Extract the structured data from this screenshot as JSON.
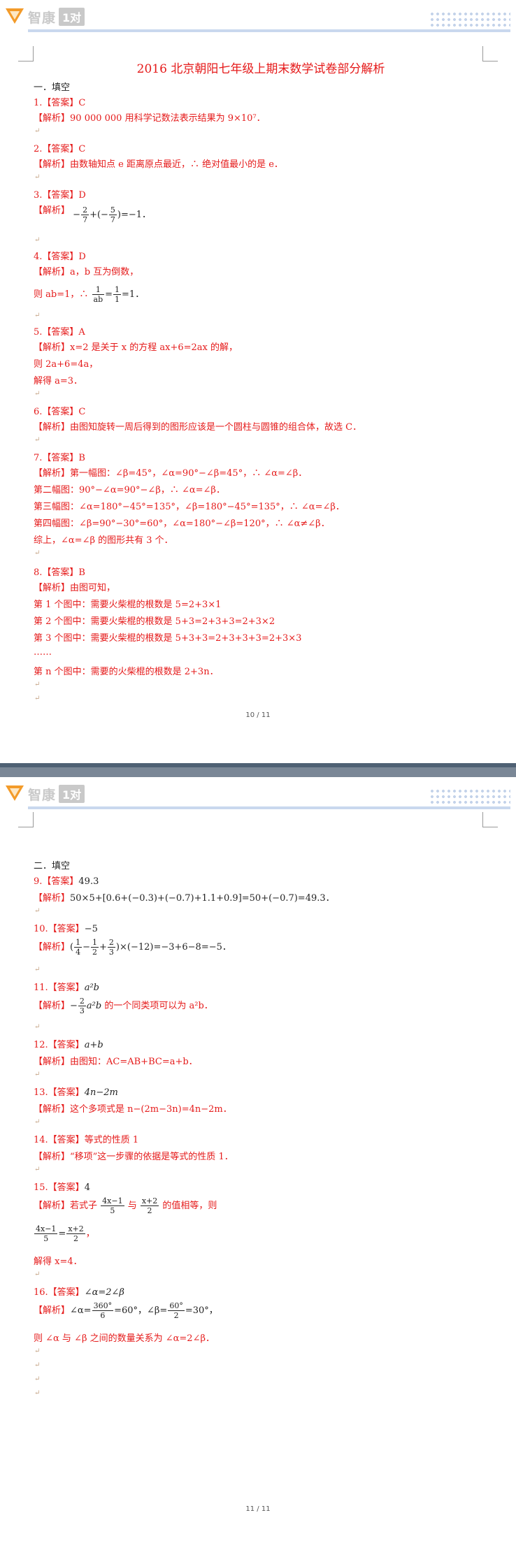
{
  "header": {
    "logo_text": "智康",
    "logo_box": "1对"
  },
  "page1": {
    "title": "2016 北京朝阳七年级上期末数学试卷部分解析",
    "section": "一．填空",
    "q1": {
      "ans": "1.【答案】C",
      "exp_label": "【解析】",
      "exp": "90 000 000 用科学记数法表示结果为 9×10⁷．"
    },
    "q2": {
      "ans": "2.【答案】C",
      "exp_label": "【解析】",
      "exp": "由数轴知点 e 距离原点最近，∴ 绝对值最小的是 e．"
    },
    "q3": {
      "ans": "3.【答案】D",
      "exp_label": "【解析】",
      "exp_a": "−",
      "f1n": "2",
      "f1d": "7",
      "exp_b": "+(−",
      "f2n": "5",
      "f2d": "7",
      "exp_c": ")=−1．"
    },
    "q4": {
      "ans": "4.【答案】D",
      "exp_label": "【解析】",
      "exp": "a，b 互为倒数，",
      "l2a": "则 ab=1，∴ ",
      "f1n": "1",
      "f1d": "ab",
      "l2b": "=",
      "f2n": "1",
      "f2d": "1",
      "l2c": "=1．"
    },
    "q5": {
      "ans": "5.【答案】A",
      "exp_label": "【解析】",
      "exp": "x=2 是关于 x 的方程 ax+6=2ax 的解，",
      "l2": "则 2a+6=4a，",
      "l3": "解得 a=3．"
    },
    "q6": {
      "ans": "6.【答案】C",
      "exp_label": "【解析】",
      "exp": "由图知旋转一周后得到的图形应该是一个圆柱与圆锥的组合体，故选 C．"
    },
    "q7": {
      "ans": "7.【答案】B",
      "exp_label": "【解析】",
      "l1": "第一幅图：∠β=45°，∠α=90°−∠β=45°，∴ ∠α=∠β．",
      "l2": "第二幅图：90°−∠α=90°−∠β，∴ ∠α=∠β．",
      "l3": "第三幅图：∠α=180°−45°=135°，∠β=180°−45°=135°，∴ ∠α=∠β．",
      "l4": "第四幅图：∠β=90°−30°=60°，∠α=180°−∠β=120°，∴ ∠α≠∠β．",
      "l5": "综上，∠α=∠β 的图形共有 3 个．"
    },
    "q8": {
      "ans": "8.【答案】B",
      "exp_label": "【解析】",
      "exp": "由图可知，",
      "l1": "第 1 个图中：需要火柴棍的根数是 5=2+3×1",
      "l2": "第 2 个图中：需要火柴棍的根数是 5+3=2+3+3=2+3×2",
      "l3": "第 3 个图中：需要火柴棍的根数是 5+3+3=2+3+3+3=2+3×3",
      "l4": "……",
      "l5": "第 n 个图中：需要的火柴棍的根数是 2+3n．"
    },
    "footer": "10 / 11"
  },
  "page2": {
    "section": "二．填空",
    "q9": {
      "ans": "9.【答案】",
      "ans_val": "49.3",
      "exp_label": "【解析】",
      "exp": "50×5+[0.6+(−0.3)+(−0.7)+1.1+0.9]=50+(−0.7)=49.3．"
    },
    "q10": {
      "ans": "10.【答案】",
      "ans_val": "−5",
      "exp_label": "【解析】",
      "a": "(",
      "f1n": "1",
      "f1d": "4",
      "b": "−",
      "f2n": "1",
      "f2d": "2",
      "c": "+",
      "f3n": "2",
      "f3d": "3",
      "d": ")×(−12)=−3+6−8=−5．"
    },
    "q11": {
      "ans": "11.【答案】",
      "ans_val": "a²b",
      "exp_label": "【解析】",
      "a": "−",
      "f1n": "2",
      "f1d": "3",
      "b": "a²b",
      "c": " 的一个同类项可以为 a²b．"
    },
    "q12": {
      "ans": "12.【答案】",
      "ans_val": "a+b",
      "exp_label": "【解析】",
      "exp": "由图知：AC=AB+BC=a+b．"
    },
    "q13": {
      "ans": "13.【答案】",
      "ans_val": "4n−2m",
      "exp_label": "【解析】",
      "exp": "这个多项式是 n−(2m−3n)=4n−2m．"
    },
    "q14": {
      "ans": "14.【答案】",
      "ans_val": "等式的性质 1",
      "exp_label": "【解析】",
      "exp": "“移项”这一步骤的依据是等式的性质 1．"
    },
    "q15": {
      "ans": "15.【答案】",
      "ans_val": "4",
      "exp_label": "【解析】",
      "a": "若式子 ",
      "f1n": "4x−1",
      "f1d": "5",
      "b": " 与 ",
      "f2n": "x+2",
      "f2d": "2",
      "c": " 的值相等，则",
      "l2_f1n": "4x−1",
      "l2_f1d": "5",
      "l2_eq": "=",
      "l2_f2n": "x+2",
      "l2_f2d": "2",
      "l2_end": "，",
      "l3": "解得 x=4．"
    },
    "q16": {
      "ans": "16.【答案】",
      "ans_val": "∠α=2∠β",
      "exp_label": "【解析】",
      "a": "∠α=",
      "f1n": "360°",
      "f1d": "6",
      "b": "=60°，∠β=",
      "f2n": "60°",
      "f2d": "2",
      "c": "=30°，",
      "l2": "则 ∠α 与 ∠β 之间的数量关系为 ∠α=2∠β．"
    },
    "footer": "11 / 11"
  }
}
